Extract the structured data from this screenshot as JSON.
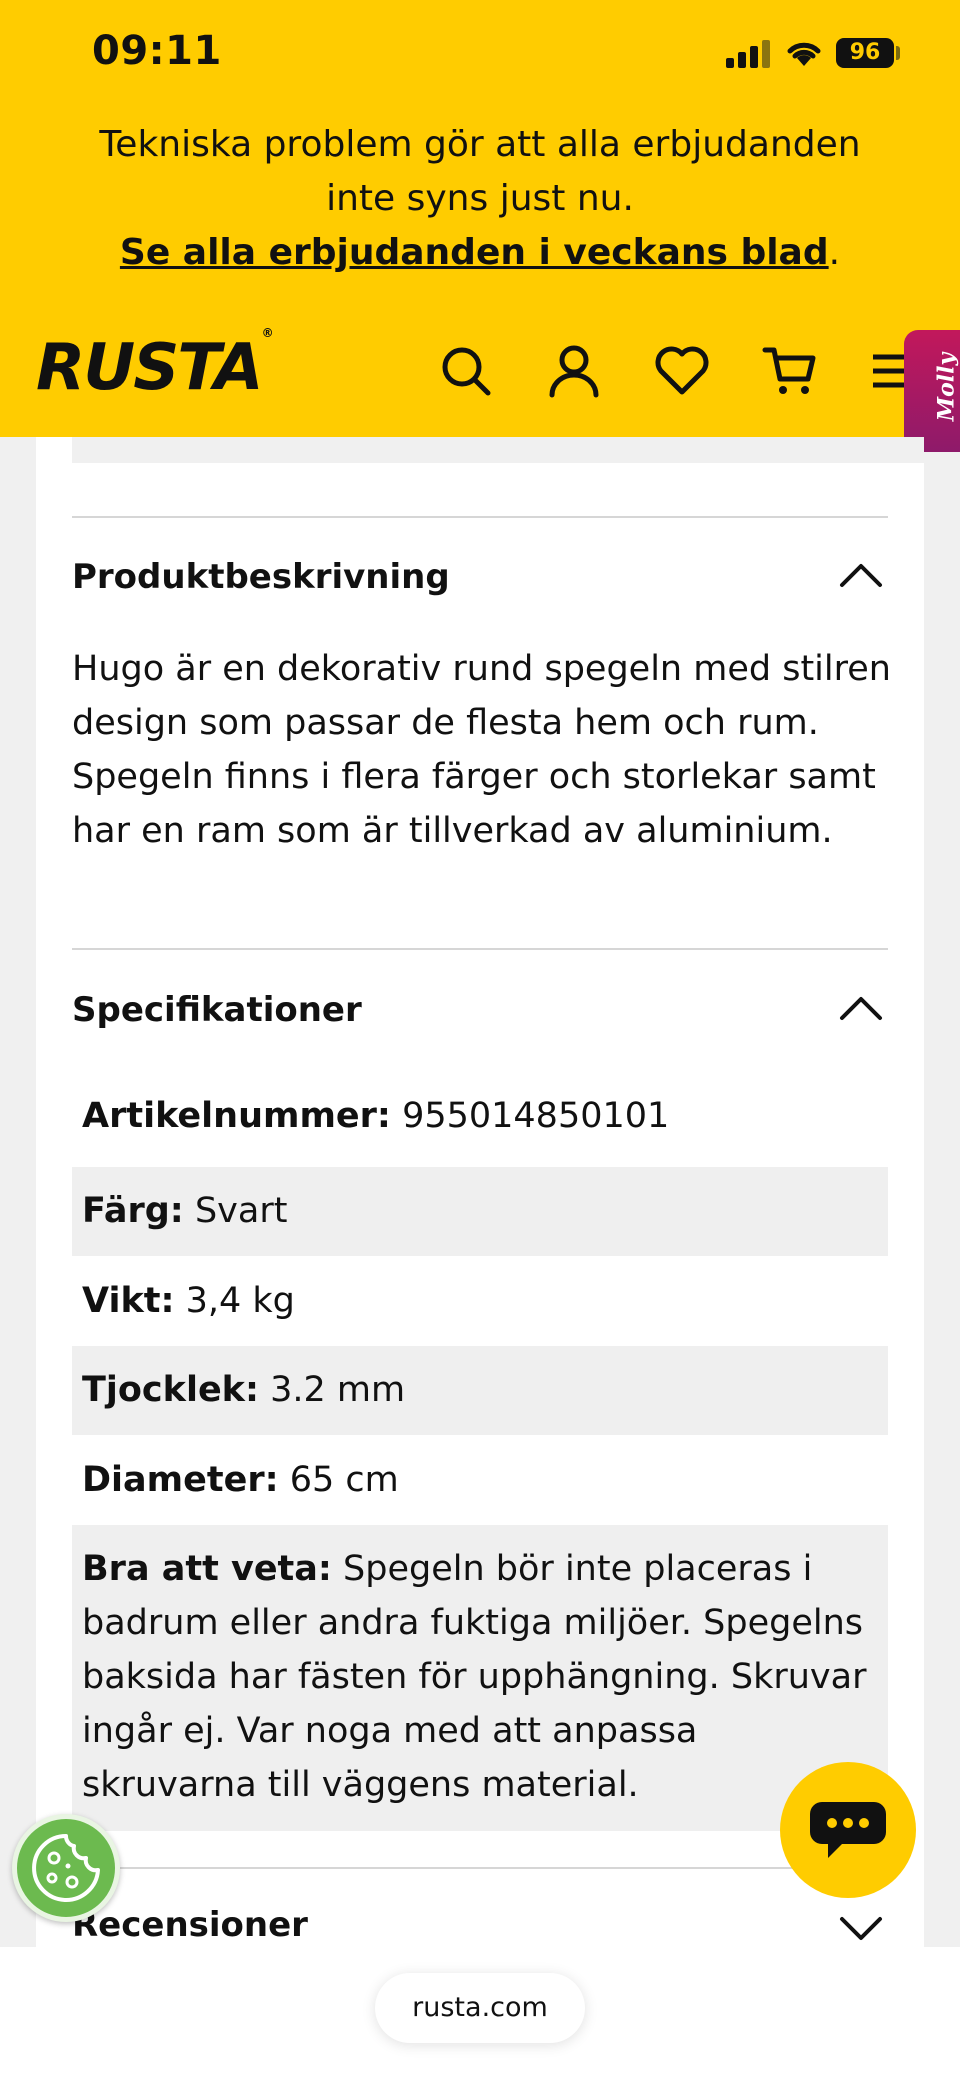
{
  "status_bar": {
    "time": "09:11",
    "battery": "96"
  },
  "notice": {
    "line1": "Tekniska problem gör att alla erbjudanden",
    "line2": "inte syns just nu.",
    "link": "Se alla erbjudanden i veckans blad",
    "link_suffix": "."
  },
  "header": {
    "logo": "RUSTA",
    "logo_mark": "®",
    "icons": [
      "search-icon",
      "account-icon",
      "heart-icon",
      "cart-icon",
      "menu-icon"
    ],
    "side_tab": "Molly"
  },
  "description": {
    "title": "Produktbeskrivning",
    "text": "Hugo är en dekorativ rund spegeln med stilren design som passar de flesta hem och rum. Spegeln finns i flera färger och storlekar samt har en ram som är tillverkad av aluminium."
  },
  "specs": {
    "title": "Specifikationer",
    "rows": [
      {
        "label": "Artikelnummer:",
        "value": "955014850101"
      },
      {
        "label": "Färg:",
        "value": "Svart"
      },
      {
        "label": "Vikt:",
        "value": "3,4 kg"
      },
      {
        "label": "Tjocklek:",
        "value": "3.2 mm"
      },
      {
        "label": "Diameter:",
        "value": "65 cm"
      },
      {
        "label": "Bra att veta:",
        "value": "Spegeln bör inte placeras i badrum eller andra fuktiga miljöer. Spegelns baksida har fästen för upphängning. Skruvar ingår ej. Var noga med att anpassa skruvarna till väggens material."
      }
    ]
  },
  "reviews": {
    "title": "Recensioner"
  },
  "browser": {
    "url": "rusta.com"
  },
  "colors": {
    "brand_yellow": "#ffcc00",
    "cookie_green": "#6cba4f",
    "molly_magenta": "#b0196a"
  }
}
